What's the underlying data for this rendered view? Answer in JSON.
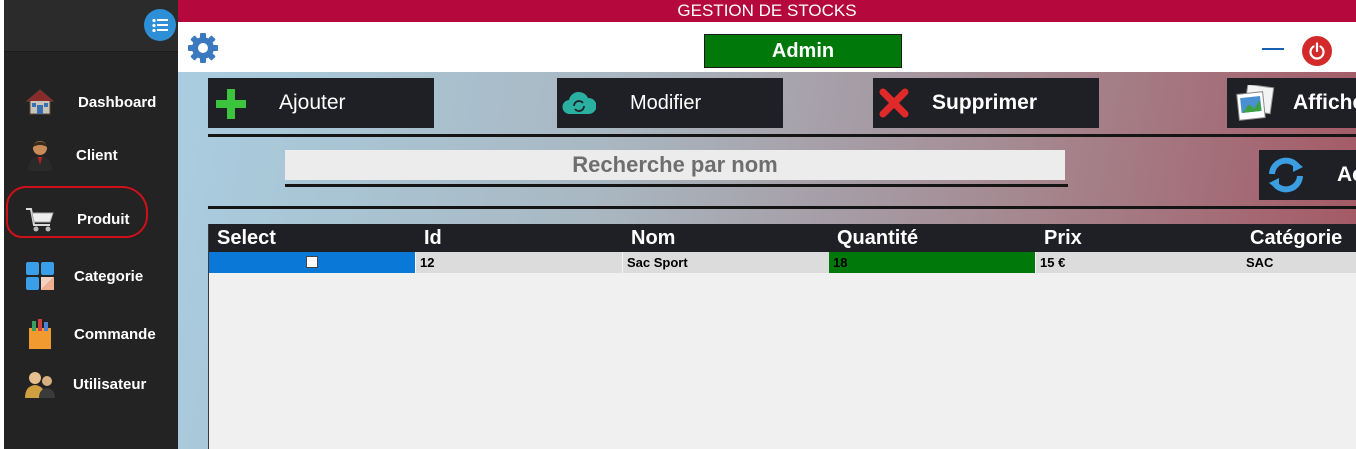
{
  "app": {
    "title": "GESTION DE STOCKS"
  },
  "header": {
    "user_label": "Admin"
  },
  "sidebar": {
    "items": [
      {
        "label": "Dashboard"
      },
      {
        "label": "Client"
      },
      {
        "label": "Produit"
      },
      {
        "label": "Categorie"
      },
      {
        "label": "Commande"
      },
      {
        "label": "Utilisateur"
      }
    ]
  },
  "toolbar": {
    "add_label": "Ajouter",
    "edit_label": "Modifier",
    "delete_label": "Supprimer",
    "show_label": "Afficher",
    "refresh_label": "Actualiser"
  },
  "search": {
    "placeholder": "Recherche par nom"
  },
  "table": {
    "columns": [
      "Select",
      "Id",
      "Nom",
      "Quantité",
      "Prix",
      "Catégorie"
    ],
    "rows": [
      {
        "id": "12",
        "nom": "Sac Sport",
        "quantite": "18",
        "prix": "15 €",
        "categorie": "SAC"
      }
    ]
  },
  "colors": {
    "titlebar": "#b5083c",
    "admin_badge": "#00780a",
    "quantity_ok": "#00780a",
    "select_cell": "#0a78d7",
    "sidebar": "#232323"
  }
}
